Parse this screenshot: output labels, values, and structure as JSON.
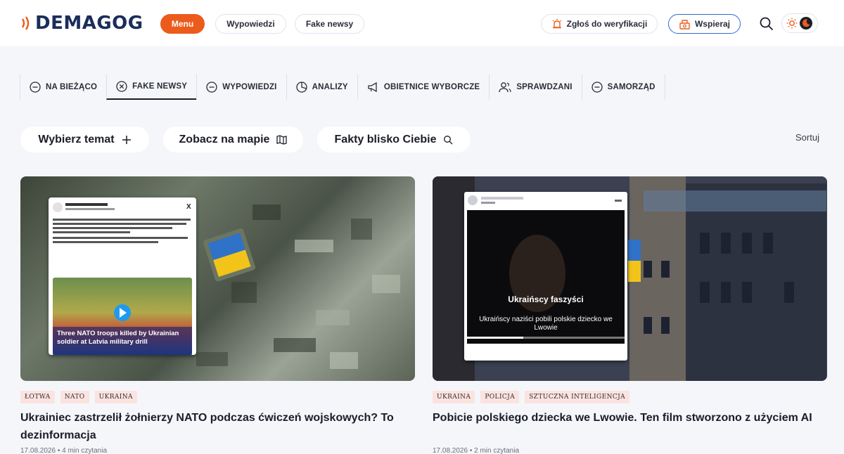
{
  "header": {
    "logo_text": "DEMAGOG",
    "menu_label": "Menu",
    "wypowiedzi_label": "Wypowiedzi",
    "fake_news_label": "Fake newsy",
    "zglos_label": "Zgłoś do weryfikacji",
    "wspieraj_label": "Wspieraj",
    "accent_color": "#ec5b1c",
    "brand_color": "#1b2d5b"
  },
  "categories": [
    {
      "label": "NA BIEŻĄCO",
      "icon": "minus-circle-icon"
    },
    {
      "label": "FAKE NEWSY",
      "icon": "x-circle-icon",
      "active": true
    },
    {
      "label": "WYPOWIEDZI",
      "icon": "minus-circle-icon"
    },
    {
      "label": "ANALIZY",
      "icon": "pie-chart-icon"
    },
    {
      "label": "OBIETNICE WYBORCZE",
      "icon": "megaphone-icon"
    },
    {
      "label": "SPRAWDZANI",
      "icon": "users-icon"
    },
    {
      "label": "SAMORZĄD",
      "icon": "minus-circle-icon"
    }
  ],
  "filters": {
    "topic_label": "Wybierz temat",
    "map_label": "Zobacz na mapie",
    "nearby_label": "Fakty blisko Ciebie",
    "sort_label": "Sortuj"
  },
  "articles": [
    {
      "tags": [
        "ŁOTWA",
        "NATO",
        "UKRAINA"
      ],
      "title": "Ukrainiec zastrzelił żołnierzy NATO podczas ćwiczeń wojskowych? To dezinformacja",
      "meta": "17.08.2026  •  4 min czytania",
      "image_text": "Three NATO troops killed by Ukrainian soldier at Latvia military drill"
    },
    {
      "tags": [
        "UKRAINA",
        "POLICJA",
        "SZTUCZNA INTELIGENCJA"
      ],
      "title": "Pobicie polskiego dziecka we Lwowie. Ten film stworzono z użyciem AI",
      "meta": "17.08.2026  •  2 min czytania",
      "image_text_main": "Ukraińscy faszyści",
      "image_text_sub": "Ukraińscy naziści pobili polskie dziecko we Lwowie"
    }
  ]
}
